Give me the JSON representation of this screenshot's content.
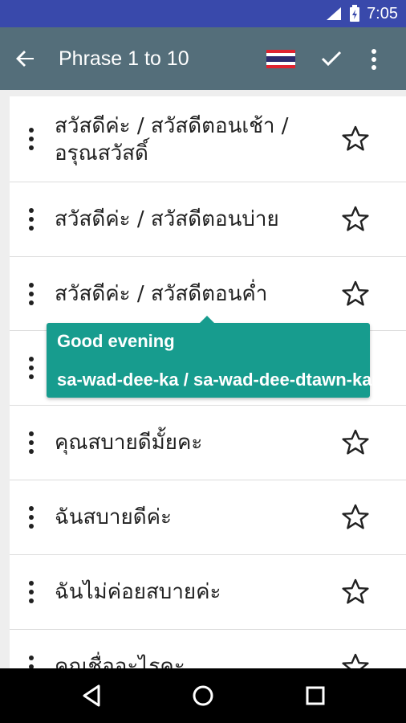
{
  "status_bar": {
    "time": "7:05",
    "icons": [
      "signal-icon",
      "battery-icon"
    ]
  },
  "app_bar": {
    "title": "Phrase 1 to 10",
    "icons": [
      "back-arrow-icon",
      "thailand-flag-icon",
      "check-icon",
      "more-vert-icon"
    ]
  },
  "phrases": [
    {
      "line1": "สวัสดีค่ะ / สวัสดีตอนเช้า /",
      "line2": "อรุณสวัสดิ์"
    },
    {
      "line1": "สวัสดีค่ะ / สวัสดีตอนบ่าย"
    },
    {
      "line1": "สวัสดีค่ะ / สวัสดีตอนค่ำ"
    },
    {
      "line1": ""
    },
    {
      "line1": "คุณสบายดีมั้ยคะ"
    },
    {
      "line1": "ฉันสบายดีค่ะ"
    },
    {
      "line1": "ฉันไม่ค่อยสบายค่ะ"
    },
    {
      "line1": "คุณชื่ออะไรคะ"
    }
  ],
  "tooltip": {
    "english": "Good evening",
    "romanization": "sa-wad-dee-ka / sa-wad-dee-dtawn-kam"
  },
  "colors": {
    "status_bar": "#3949ab",
    "app_bar": "#546e7a",
    "tooltip": "#179c8e"
  }
}
